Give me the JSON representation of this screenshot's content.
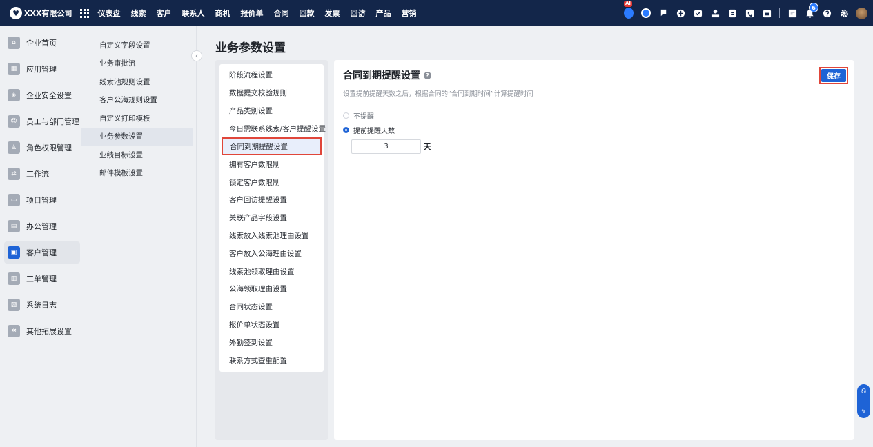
{
  "topbar": {
    "company": "XXX有限公司",
    "nav": [
      "仪表盘",
      "线索",
      "客户",
      "联系人",
      "商机",
      "报价单",
      "合同",
      "回款",
      "发票",
      "回访",
      "产品",
      "营销"
    ],
    "ai_badge": "AI",
    "notification_count": "6",
    "icons": [
      "robot-icon",
      "chat-icon",
      "flag-icon",
      "globe-icon",
      "mail-icon",
      "user-icon",
      "doc-icon",
      "phone-icon",
      "calendar-icon",
      "report-icon",
      "bell-icon",
      "help-icon",
      "gear-icon"
    ]
  },
  "sidebar": {
    "items": [
      {
        "label": "企业首页",
        "icon": "home-icon"
      },
      {
        "label": "应用管理",
        "icon": "apps-icon"
      },
      {
        "label": "企业安全设置",
        "icon": "shield-icon"
      },
      {
        "label": "员工与部门管理",
        "icon": "people-icon"
      },
      {
        "label": "角色权限管理",
        "icon": "role-icon"
      },
      {
        "label": "工作流",
        "icon": "workflow-icon"
      },
      {
        "label": "项目管理",
        "icon": "project-icon"
      },
      {
        "label": "办公管理",
        "icon": "office-icon"
      },
      {
        "label": "客户管理",
        "icon": "customer-icon"
      },
      {
        "label": "工单管理",
        "icon": "ticket-icon"
      },
      {
        "label": "系统日志",
        "icon": "log-icon"
      },
      {
        "label": "其他拓展设置",
        "icon": "extension-icon"
      }
    ],
    "active_index": 8
  },
  "subnav": {
    "items": [
      "自定义字段设置",
      "业务审批流",
      "线索池规则设置",
      "客户公海规则设置",
      "自定义打印模板",
      "业务参数设置",
      "业绩目标设置",
      "邮件模板设置"
    ],
    "active_index": 5
  },
  "page": {
    "title": "业务参数设置"
  },
  "param_menu": {
    "items": [
      "阶段流程设置",
      "数据提交校验规则",
      "产品类别设置",
      "今日需联系线索/客户提醒设置",
      "合同到期提醒设置",
      "拥有客户数限制",
      "锁定客户数限制",
      "客户回访提醒设置",
      "关联产品字段设置",
      "线索放入线索池理由设置",
      "客户放入公海理由设置",
      "线索池领取理由设置",
      "公海领取理由设置",
      "合同状态设置",
      "报价单状态设置",
      "外勤签到设置",
      "联系方式查重配置"
    ],
    "active_index": 4
  },
  "content": {
    "title": "合同到期提醒设置",
    "help_glyph": "?",
    "description": "设置提前提醒天数之后，根据合同的“合同到期时间”计算提醒时间",
    "save_label": "保存",
    "options": [
      {
        "label": "不提醒",
        "selected": false
      },
      {
        "label": "提前提醒天数",
        "selected": true
      }
    ],
    "days_value": "3",
    "days_unit": "天"
  },
  "colors": {
    "topbar_bg": "#13264a",
    "primary": "#1e63d6",
    "highlight_border": "#e0463a"
  }
}
